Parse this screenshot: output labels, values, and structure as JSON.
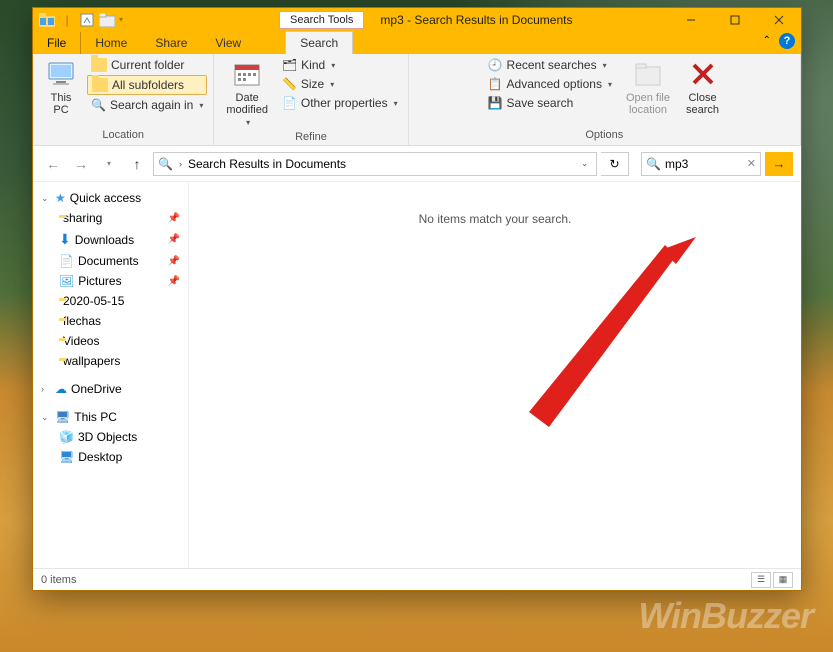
{
  "window": {
    "tools_tab": "Search Tools",
    "title": "mp3 - Search Results in Documents"
  },
  "tabs": {
    "file": "File",
    "home": "Home",
    "share": "Share",
    "view": "View",
    "search": "Search"
  },
  "ribbon": {
    "location": {
      "this_pc": "This\nPC",
      "current_folder": "Current folder",
      "all_subfolders": "All subfolders",
      "search_again": "Search again in",
      "label": "Location"
    },
    "refine": {
      "date_modified": "Date\nmodified",
      "kind": "Kind",
      "size": "Size",
      "other_props": "Other properties",
      "label": "Refine"
    },
    "options": {
      "recent": "Recent searches",
      "advanced": "Advanced options",
      "save": "Save search",
      "open_loc": "Open file\nlocation",
      "close": "Close\nsearch",
      "label": "Options"
    }
  },
  "address": {
    "path": "Search Results in Documents"
  },
  "search": {
    "query": "mp3"
  },
  "sidebar": {
    "quick_access": "Quick access",
    "items": [
      {
        "label": "sharing",
        "pin": true,
        "icon": "folder"
      },
      {
        "label": "Downloads",
        "pin": true,
        "icon": "download"
      },
      {
        "label": "Documents",
        "pin": true,
        "icon": "document"
      },
      {
        "label": "Pictures",
        "pin": true,
        "icon": "picture"
      },
      {
        "label": "2020-05-15",
        "pin": false,
        "icon": "folder"
      },
      {
        "label": "flechas",
        "pin": false,
        "icon": "folder"
      },
      {
        "label": "Videos",
        "pin": false,
        "icon": "folder"
      },
      {
        "label": "wallpapers",
        "pin": false,
        "icon": "folder"
      }
    ],
    "onedrive": "OneDrive",
    "this_pc": "This PC",
    "pc_items": [
      {
        "label": "3D Objects",
        "icon": "3d"
      },
      {
        "label": "Desktop",
        "icon": "desktop"
      }
    ]
  },
  "main": {
    "empty": "No items match your search."
  },
  "status": {
    "count": "0 items"
  },
  "watermark": "WinBuzzer"
}
